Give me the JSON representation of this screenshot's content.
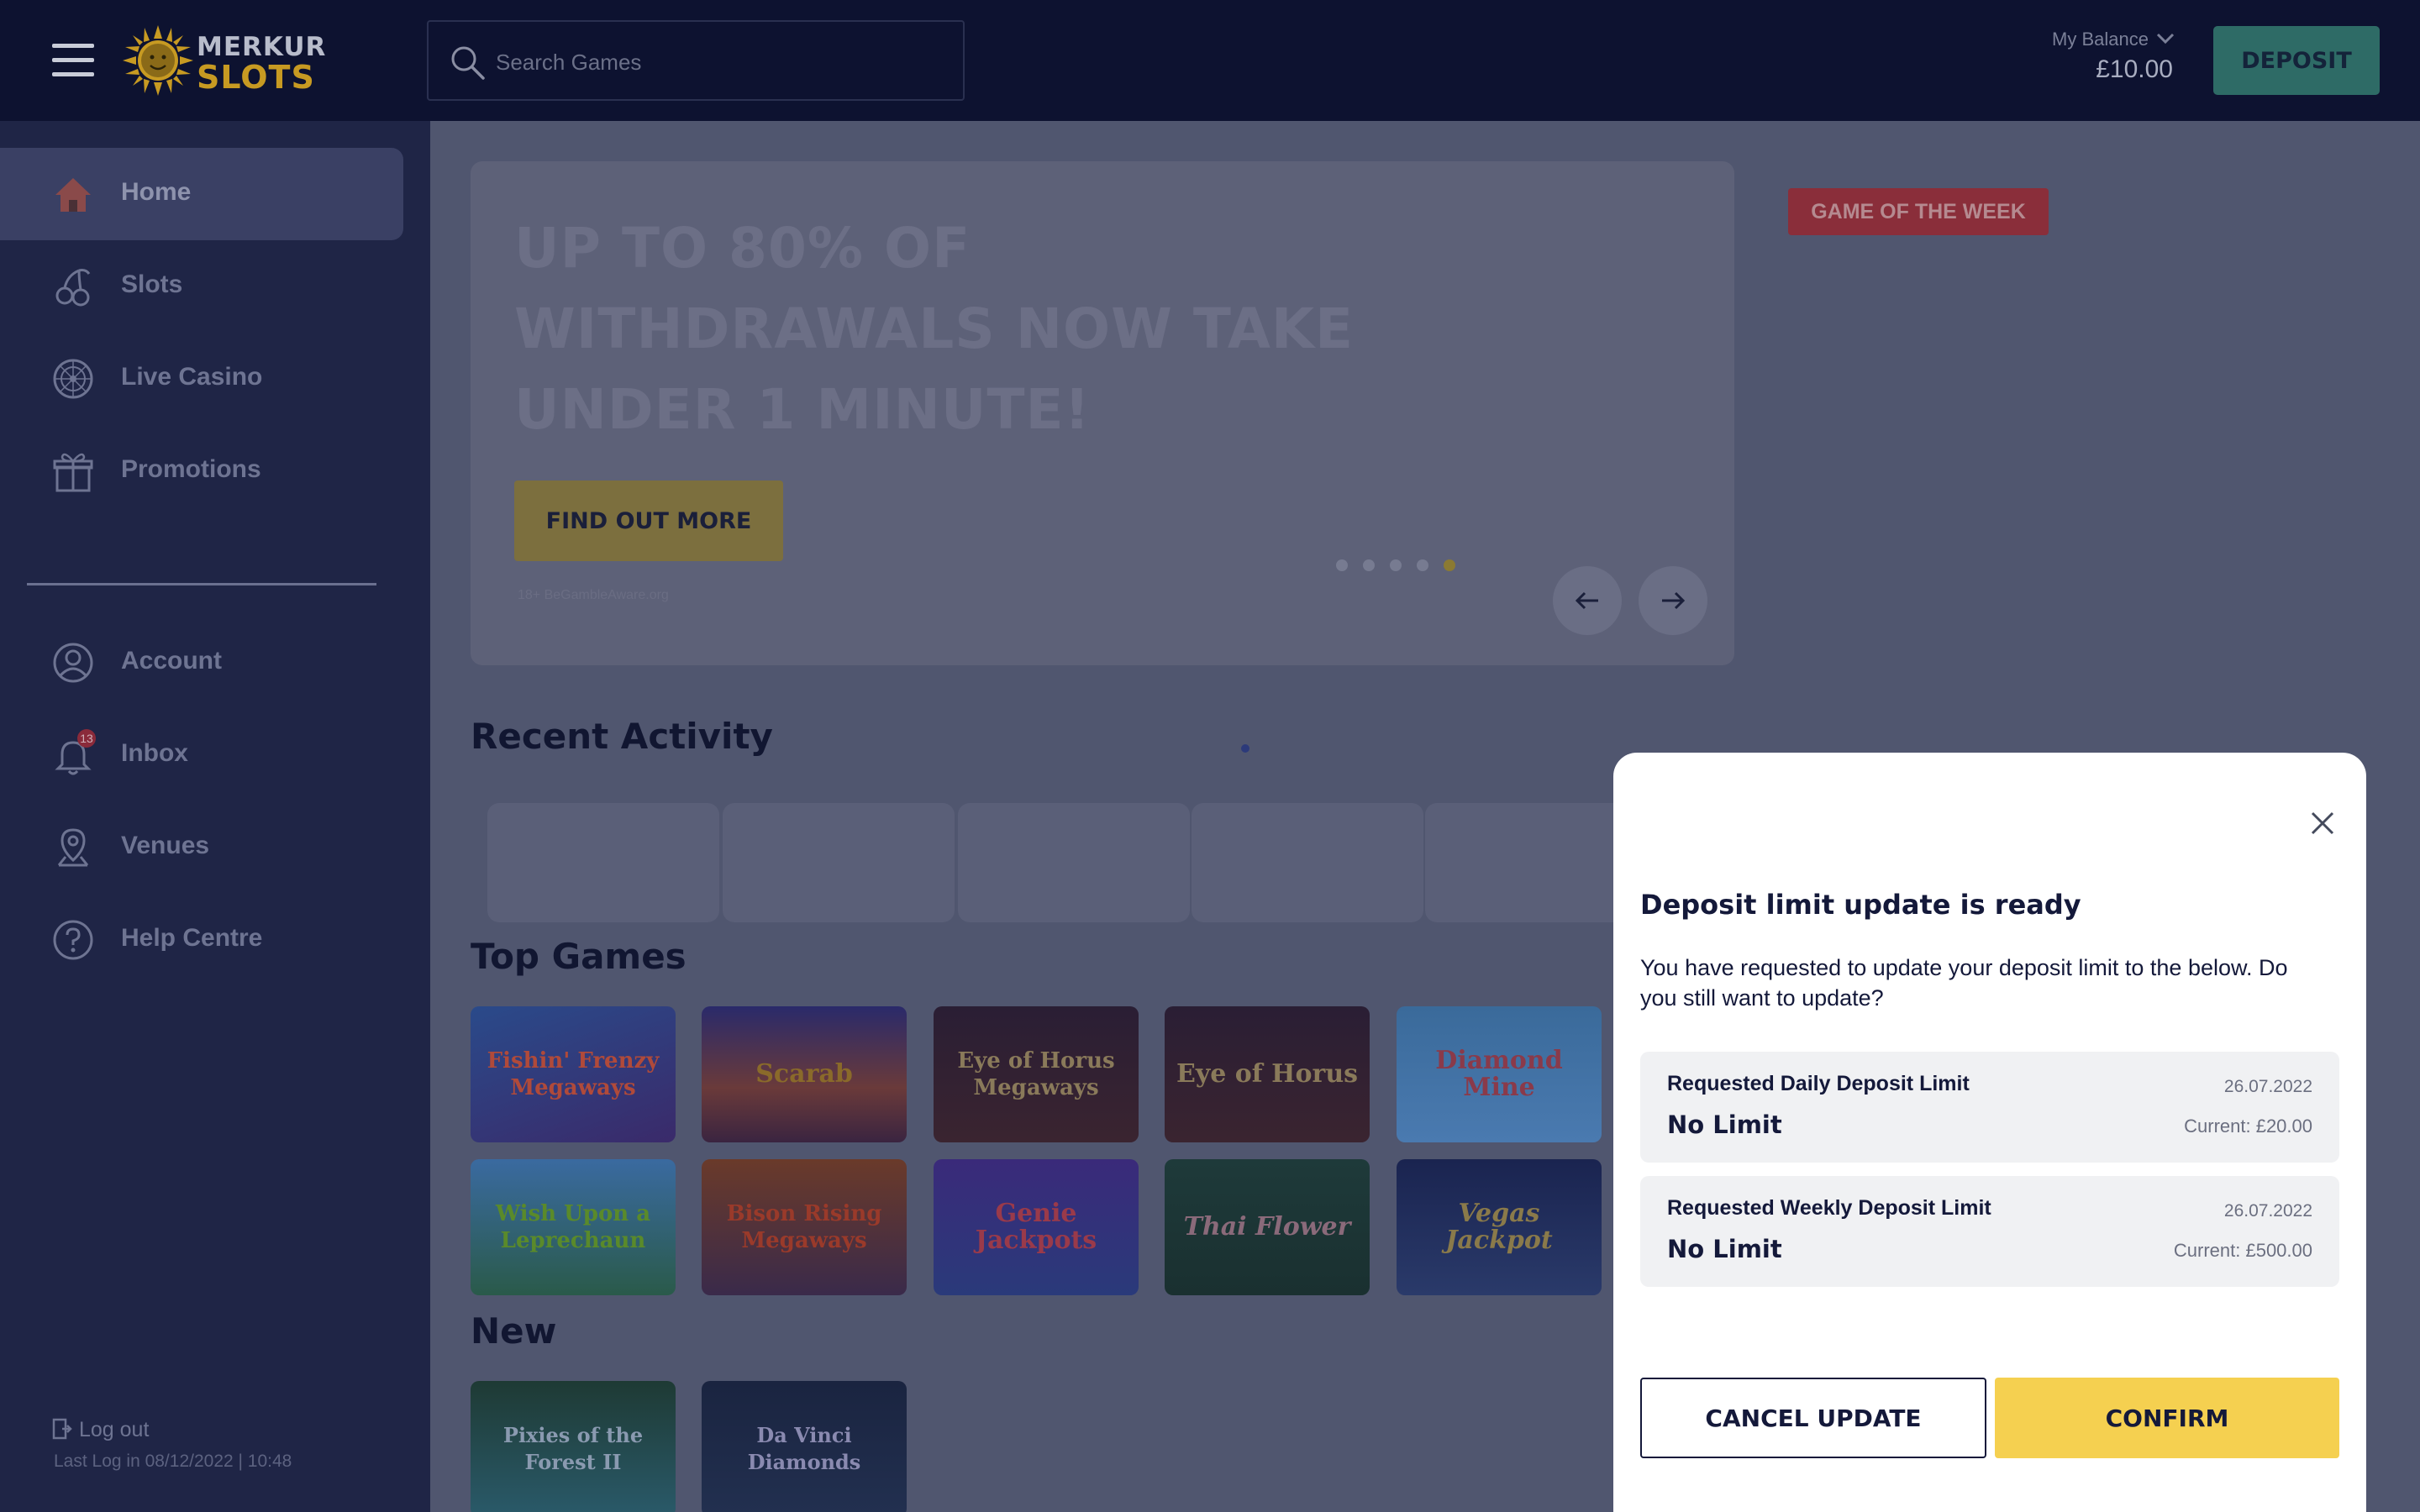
{
  "header": {
    "logo_top": "MERKUR",
    "logo_bottom": "SLOTS",
    "search_placeholder": "Search Games",
    "balance_label": "My Balance",
    "balance_value": "£10.00",
    "deposit_label": "DEPOSIT"
  },
  "sidebar": {
    "items": [
      {
        "label": "Home",
        "icon": "home-icon",
        "active": true
      },
      {
        "label": "Slots",
        "icon": "cherries-icon"
      },
      {
        "label": "Live Casino",
        "icon": "roulette-icon"
      },
      {
        "label": "Promotions",
        "icon": "gift-icon"
      },
      {
        "label": "Account",
        "icon": "user-icon"
      },
      {
        "label": "Inbox",
        "icon": "bell-icon",
        "badge": "13"
      },
      {
        "label": "Venues",
        "icon": "map-pin-icon"
      },
      {
        "label": "Help Centre",
        "icon": "help-icon"
      }
    ],
    "logout_label": "Log out",
    "last_login": "Last Log in 08/12/2022 | 10:48"
  },
  "hero": {
    "title": "UP TO 80% OF WITHDRAWALS NOW TAKE UNDER 1 MINUTE!",
    "cta_label": "FIND OUT MORE",
    "small_text": "18+ BeGambleAware.org",
    "slide_count": 5,
    "active_slide": 5,
    "game_of_week_label": "GAME OF THE WEEK"
  },
  "sections": {
    "recent_activity": "Recent Activity",
    "top_games": "Top Games",
    "new": "New"
  },
  "top_games": [
    "Fishin' Frenzy Megaways",
    "Scarab",
    "Eye of Horus Megaways",
    "Eye of Horus",
    "Diamond Mine",
    "Wish Upon a Leprechaun",
    "Bison Rising Megaways",
    "Genie Jackpots",
    "Thai Flower",
    "Vegas Jackpot"
  ],
  "new_games": [
    "Pixies of the Forest II",
    "Da Vinci Diamonds"
  ],
  "modal": {
    "title": "Deposit limit update is ready",
    "description": "You have requested to update your deposit limit to the below. Do you still want to update?",
    "limits": [
      {
        "label": "Requested Daily Deposit Limit",
        "value": "No Limit",
        "date": "26.07.2022",
        "current": "Current: £20.00"
      },
      {
        "label": "Requested Weekly Deposit Limit",
        "value": "No Limit",
        "date": "26.07.2022",
        "current": "Current: £500.00"
      }
    ],
    "cancel_label": "CANCEL UPDATE",
    "confirm_label": "CONFIRM"
  },
  "colors": {
    "header_bg": "#0d1230",
    "sidebar_bg": "#1f2546",
    "deposit_green": "#2e6b66",
    "confirm_yellow": "#f5d050",
    "game_of_week_red": "#8a2e3a"
  }
}
